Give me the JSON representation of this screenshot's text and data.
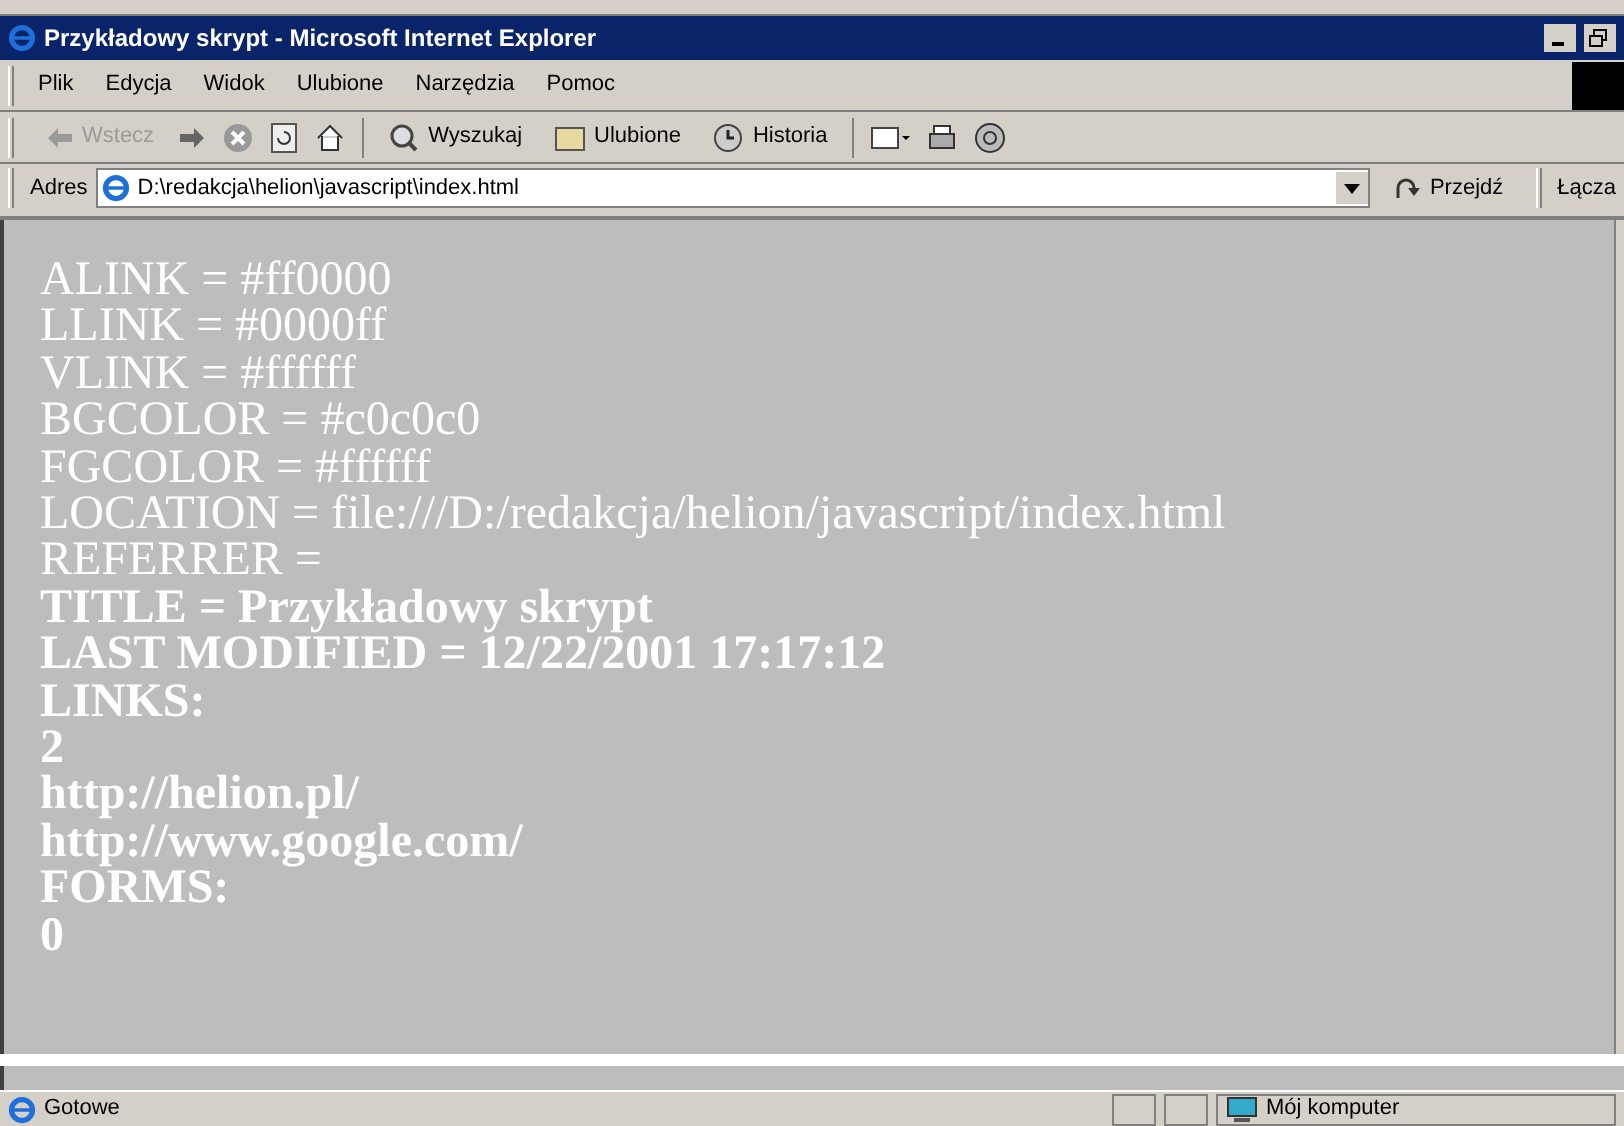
{
  "window": {
    "title": "Przykładowy skrypt - Microsoft Internet Explorer"
  },
  "menu": [
    "Plik",
    "Edycja",
    "Widok",
    "Ulubione",
    "Narzędzia",
    "Pomoc"
  ],
  "toolbar": {
    "back": {
      "label": "Wstecz",
      "disabled": true
    },
    "buttons": [
      {
        "kind": "search",
        "label": "Wyszukaj"
      },
      {
        "kind": "favorites",
        "label": "Ulubione"
      },
      {
        "kind": "history",
        "label": "Historia"
      }
    ]
  },
  "address_bar": {
    "label": "Adres",
    "value": "D:\\redakcja\\helion\\javascript\\index.html",
    "go": "Przejdź",
    "links": "Łącza"
  },
  "content": [
    {
      "text": "ALINK = #ff0000",
      "bold": false
    },
    {
      "text": "LLINK = #0000ff",
      "bold": false
    },
    {
      "text": "VLINK = #ffffff",
      "bold": false
    },
    {
      "text": "BGCOLOR = #c0c0c0",
      "bold": false
    },
    {
      "text": "FGCOLOR = #ffffff",
      "bold": false
    },
    {
      "text": "LOCATION = file:///D:/redakcja/helion/javascript/index.html",
      "bold": false
    },
    {
      "text": "REFERRER =",
      "bold": false
    },
    {
      "text": "TITLE = Przykładowy skrypt",
      "bold": true
    },
    {
      "text": "LAST MODIFIED = 12/22/2001 17:17:12",
      "bold": true
    },
    {
      "text": "LINKS:",
      "bold": true
    },
    {
      "text": "2",
      "bold": true
    },
    {
      "text": "http://helion.pl/",
      "bold": true
    },
    {
      "text": "http://www.google.com/",
      "bold": true
    },
    {
      "text": "FORMS:",
      "bold": true
    },
    {
      "text": "0",
      "bold": true
    }
  ],
  "status_bar": {
    "text": "Gotowe",
    "zone": "Mój komputer"
  }
}
